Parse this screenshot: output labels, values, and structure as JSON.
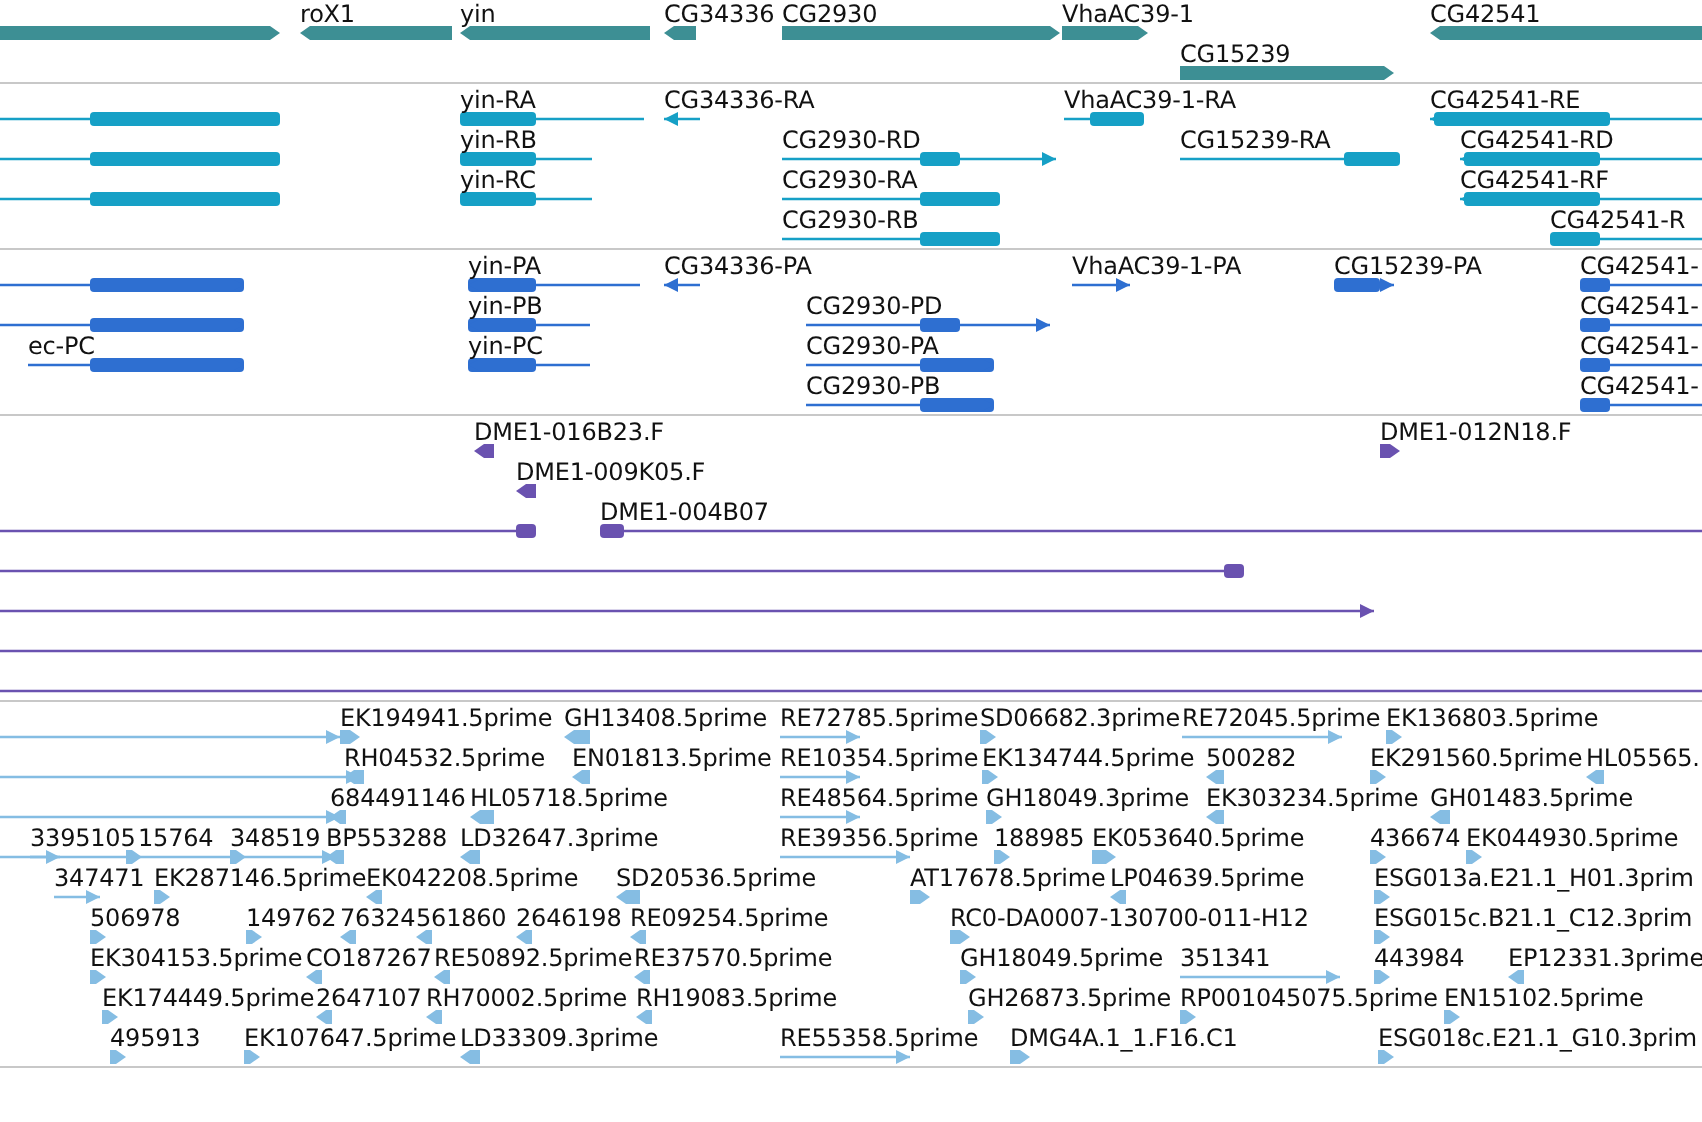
{
  "tracks": [
    {
      "kind": "gene",
      "features": [
        {
          "reverse": false
        },
        {
          "label": "roX1",
          "reverse": true
        },
        {
          "label": "yin",
          "reverse": true
        },
        {
          "label": "CG34336",
          "reverse": true
        },
        {
          "label": "CG2930",
          "reverse": false
        },
        {
          "label": "VhaAC39-1",
          "reverse": false
        },
        {
          "label": "CG42541",
          "reverse": true
        },
        {
          "label": "CG15239",
          "reverse": false
        }
      ]
    },
    {
      "kind": "transcript",
      "features": [
        {
          "reverse": false
        },
        {
          "label": "yin-RA",
          "reverse": true
        },
        {
          "label": "CG34336-RA",
          "reverse": true
        },
        {
          "label": "VhaAC39-1-RA",
          "reverse": false
        },
        {
          "label": "CG42541-RE",
          "reverse": true
        },
        {
          "reverse": false
        },
        {
          "label": "yin-RB",
          "reverse": true
        },
        {
          "label": "CG2930-RD",
          "reverse": false
        },
        {
          "label": "CG15239-RA",
          "reverse": false
        },
        {
          "label": "CG42541-RD",
          "reverse": true
        },
        {
          "reverse": false
        },
        {
          "label": "yin-RC",
          "reverse": true
        },
        {
          "label": "CG2930-RA",
          "reverse": false
        },
        {
          "label": "CG42541-RF",
          "reverse": true
        },
        {
          "label": "CG2930-RB",
          "reverse": false
        },
        {
          "label": "CG42541-R",
          "reverse": true
        }
      ]
    },
    {
      "kind": "protein",
      "features": [
        {
          "reverse": false
        },
        {
          "label": "yin-PA",
          "reverse": true
        },
        {
          "label": "CG34336-PA",
          "reverse": true
        },
        {
          "label": "VhaAC39-1-PA",
          "reverse": false
        },
        {
          "label": "CG15239-PA",
          "reverse": false
        },
        {
          "label": "CG42541-",
          "reverse": true
        },
        {
          "reverse": false
        },
        {
          "label": "yin-PB",
          "reverse": true
        },
        {
          "label": "CG2930-PD",
          "reverse": false
        },
        {
          "label": "CG42541-",
          "reverse": true
        },
        {
          "label": "ec-PC",
          "reverse": false
        },
        {
          "label": "yin-PC",
          "reverse": true
        },
        {
          "label": "CG2930-PA",
          "reverse": false
        },
        {
          "label": "CG42541-",
          "reverse": true
        },
        {
          "label": "CG2930-PB",
          "reverse": false
        },
        {
          "label": "CG42541-",
          "reverse": true
        }
      ]
    },
    {
      "kind": "clone",
      "features": [
        {
          "label": "DME1-016B23.F",
          "reverse": true
        },
        {
          "label": "DME1-012N18.F",
          "reverse": false
        },
        {
          "label": "DME1-009K05.F",
          "reverse": true
        },
        {
          "reverse": false
        },
        {
          "label": "DME1-004B07",
          "reverse": true
        },
        {
          "reverse": false
        },
        {
          "reverse": false
        },
        {
          "clipped": true
        },
        {
          "clipped": true
        }
      ]
    },
    {
      "kind": "est",
      "features": [
        {
          "reverse": false
        },
        {
          "label": "EK194941.5prime",
          "reverse": false
        },
        {
          "label": "GH13408.5prime",
          "reverse": true
        },
        {
          "label": "RE72785.5prime",
          "reverse": false
        },
        {
          "label": "SD06682.3prime",
          "reverse": false
        },
        {
          "label": "RE72045.5prime",
          "reverse": false
        },
        {
          "label": "EK136803.5prime",
          "reverse": false
        },
        {
          "reverse": false
        },
        {
          "label": "RH04532.5prime",
          "reverse": true
        },
        {
          "label": "EN01813.5prime",
          "reverse": true
        },
        {
          "label": "RE10354.5prime",
          "reverse": false
        },
        {
          "label": "EK134744.5prime",
          "reverse": false
        },
        {
          "label": "500282",
          "reverse": true
        },
        {
          "label": "EK291560.5prime",
          "reverse": false
        },
        {
          "label": "HL05565.",
          "reverse": true
        },
        {
          "reverse": false
        },
        {
          "label": "684491146",
          "reverse": true
        },
        {
          "label": "HL05718.5prime",
          "reverse": true
        },
        {
          "label": "RE48564.5prime",
          "reverse": false
        },
        {
          "label": "GH18049.3prime",
          "reverse": false
        },
        {
          "label": "EK303234.5prime",
          "reverse": true
        },
        {
          "label": "GH01483.5prime",
          "reverse": true
        },
        {
          "reverse": false
        },
        {
          "label": "3395105",
          "reverse": false
        },
        {
          "label": "15764",
          "reverse": false
        },
        {
          "label": "348519",
          "reverse": false
        },
        {
          "label": "BP553288",
          "reverse": true
        },
        {
          "label": "LD32647.3prime",
          "reverse": true
        },
        {
          "label": "RE39356.5prime",
          "reverse": false
        },
        {
          "label": "188985",
          "reverse": false
        },
        {
          "label": "EK053640.5prime",
          "reverse": false
        },
        {
          "label": "436674",
          "reverse": false
        },
        {
          "label": "EK044930.5prime",
          "reverse": false
        },
        {
          "label": "347471",
          "reverse": false
        },
        {
          "label": "EK287146.5prime",
          "reverse": false
        },
        {
          "label": "EK042208.5prime",
          "reverse": true
        },
        {
          "label": "SD20536.5prime",
          "reverse": true
        },
        {
          "label": "AT17678.5prime",
          "reverse": false
        },
        {
          "label": "LP04639.5prime",
          "reverse": true
        },
        {
          "label": "ESG013a.E21.1_H01.3prim",
          "reverse": false
        },
        {
          "label": "506978",
          "reverse": false
        },
        {
          "label": "149762",
          "reverse": false
        },
        {
          "label": "76324",
          "reverse": true
        },
        {
          "label": "561860",
          "reverse": true
        },
        {
          "label": "2646198",
          "reverse": true
        },
        {
          "label": "RE09254.5prime",
          "reverse": true
        },
        {
          "label": "RC0-DA0007-130700-011-H12",
          "reverse": false
        },
        {
          "label": "ESG015c.B21.1_C12.3prim",
          "reverse": false
        },
        {
          "label": "EK304153.5prime",
          "reverse": false
        },
        {
          "label": "CO187267",
          "reverse": true
        },
        {
          "label": "RE50892.5prime",
          "reverse": true
        },
        {
          "label": "RE37570.5prime",
          "reverse": true
        },
        {
          "label": "GH18049.5prime",
          "reverse": false
        },
        {
          "label": "351341",
          "reverse": false
        },
        {
          "label": "443984",
          "reverse": false
        },
        {
          "label": "EP12331.3prime",
          "reverse": true
        },
        {
          "label": "EK174449.5prime",
          "reverse": false
        },
        {
          "label": "2647107",
          "reverse": true
        },
        {
          "label": "RH70002.5prime",
          "reverse": true
        },
        {
          "label": "RH19083.5prime",
          "reverse": true
        },
        {
          "label": "GH26873.5prime",
          "reverse": false
        },
        {
          "label": "RP001045075.5prime",
          "reverse": false
        },
        {
          "label": "EN15102.5prime",
          "reverse": false
        },
        {
          "label": "495913",
          "reverse": false
        },
        {
          "label": "EK107647.5prime",
          "reverse": false
        },
        {
          "label": "LD33309.3prime",
          "reverse": true
        },
        {
          "label": "RE55358.5prime",
          "reverse": false
        },
        {
          "label": "DMG4A.1_1.F16.C1",
          "reverse": false
        },
        {
          "label": "ESG018c.E21.1_G10.3prim",
          "reverse": false
        }
      ]
    }
  ]
}
